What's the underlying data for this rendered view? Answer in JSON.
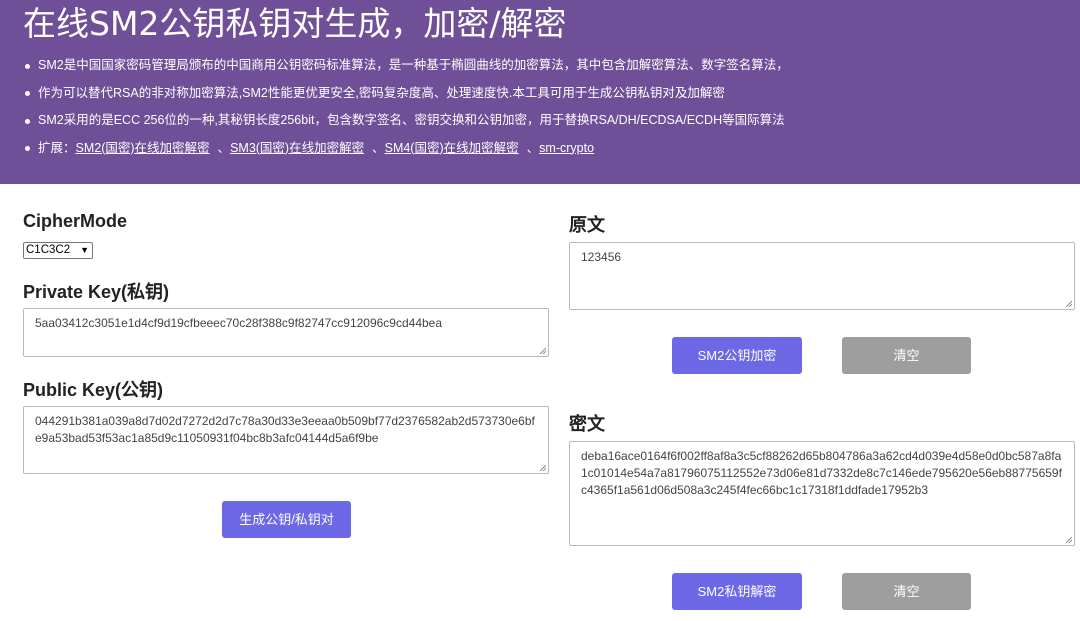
{
  "header": {
    "title": "在线SM2公钥私钥对生成，加密/解密",
    "bullets": [
      "SM2是中国国家密码管理局颁布的中国商用公钥密码标准算法，是一种基于椭圆曲线的加密算法，其中包含加解密算法、数字签名算法，",
      "作为可以替代RSA的非对称加密算法,SM2性能更优更安全,密码复杂度高、处理速度快.本工具可用于生成公钥私钥对及加解密",
      "SM2采用的是ECC 256位的一种,其秘钥长度256bit，包含数字签名、密钥交换和公钥加密，用于替换RSA/DH/ECDSA/ECDH等国际算法"
    ],
    "ext_prefix": "扩展：",
    "ext_links": [
      "SM2(国密)在线加密解密",
      "SM3(国密)在线加密解密",
      "SM4(国密)在线加密解密",
      "sm-crypto"
    ],
    "link_separator": "、"
  },
  "left": {
    "cipher_mode_label": "CipherMode",
    "cipher_mode_value": "C1C3C2",
    "private_key_label": "Private Key(私钥)",
    "private_key_value": "5aa03412c3051e1d4cf9d19cfbeeec70c28f388c9f82747cc912096c9cd44bea",
    "public_key_label": "Public Key(公钥)",
    "public_key_value": "044291b381a039a8d7d02d7272d2d7c78a30d33e3eeaa0b509bf77d2376582ab2d573730e6bfe9a53bad53f53ac1a85d9c11050931f04bc8b3afc04144d5a6f9be",
    "generate_button": "生成公钥/私钥对"
  },
  "right": {
    "plaintext_label": "原文",
    "plaintext_value": "123456",
    "encrypt_button": "SM2公钥加密",
    "clear_button_1": "清空",
    "ciphertext_label": "密文",
    "ciphertext_value": "deba16ace0164f6f002ff8af8a3c5cf88262d65b804786a3a62cd4d039e4d58e0d0bc587a8fa1c01014e54a7a81796075112552e73d06e81d7332de8c7c146ede795620e56eb88775659fc4365f1a561d06d508a3c245f4fec66bc1c17318f1ddfade17952b3",
    "decrypt_button": "SM2私钥解密",
    "clear_button_2": "清空"
  },
  "colors": {
    "header_bg": "#6f4f97",
    "primary_button": "#6c68e6",
    "gray_button": "#9e9e9e"
  }
}
